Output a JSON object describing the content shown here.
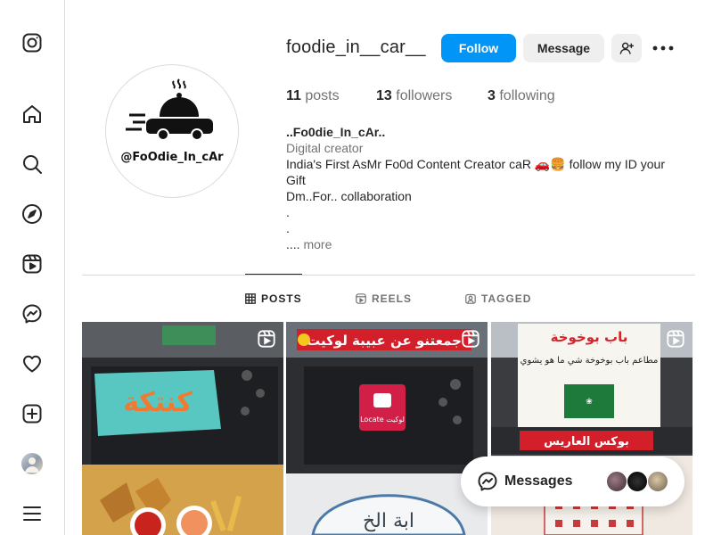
{
  "sidebar": {
    "items": [
      {
        "name": "instagram-logo",
        "label": "Instagram"
      },
      {
        "name": "home",
        "label": "Home"
      },
      {
        "name": "search",
        "label": "Search"
      },
      {
        "name": "explore",
        "label": "Explore"
      },
      {
        "name": "reels",
        "label": "Reels"
      },
      {
        "name": "messages",
        "label": "Messages"
      },
      {
        "name": "notifications",
        "label": "Notifications"
      },
      {
        "name": "create",
        "label": "Create"
      },
      {
        "name": "profile",
        "label": "Profile"
      },
      {
        "name": "more",
        "label": "More"
      }
    ]
  },
  "profile": {
    "username": "foodie_in__car__",
    "follow_label": "Follow",
    "message_label": "Message",
    "logo_text": "@FoOdie_In_cAr",
    "stats": {
      "posts_count": "11",
      "posts_label": "posts",
      "followers_count": "13",
      "followers_label": "followers",
      "following_count": "3",
      "following_label": "following"
    },
    "bio": {
      "name": "..Fo0die_In_cAr..",
      "category": "Digital creator",
      "line1": "India's First AsMr Fo0d Content Creator caR 🚗🍔 follow my ID your Gift",
      "line2": "Dm..For.. collaboration",
      "line3": ".",
      "line4": ".",
      "line5_prefix": "....",
      "more": "more"
    }
  },
  "tabs": [
    {
      "label": "POSTS",
      "active": true
    },
    {
      "label": "REELS",
      "active": false
    },
    {
      "label": "TAGGED",
      "active": false
    }
  ],
  "posts": [
    {
      "caption_text": "كنتكة",
      "type": "reel"
    },
    {
      "caption_text": "جمعتنو عن عبيبة لوكيت",
      "badge": "Locate لوكيت",
      "type": "reel"
    },
    {
      "caption_text": "باب بوخوخة",
      "sub": "مطاعم باب بوخوخة شي ما هو يشوي",
      "banner": "بوكس العاريس",
      "type": "reel"
    }
  ],
  "messages_bar": {
    "label": "Messages"
  },
  "colors": {
    "accent": "#0095f6",
    "secondary_button": "#efefef",
    "text_primary": "#262626",
    "text_secondary": "#737373"
  }
}
